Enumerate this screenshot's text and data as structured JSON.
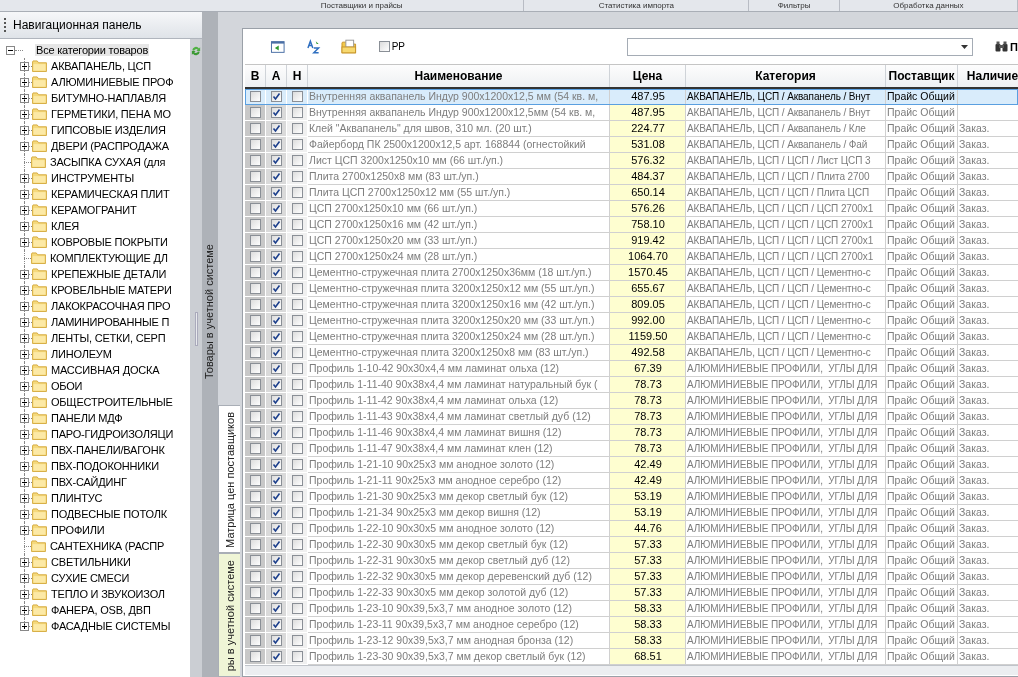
{
  "ribbon_tabs": [
    {
      "label": "Поставщики и прайсы"
    },
    {
      "label": "Статистика импорта"
    },
    {
      "label": "Фильтры"
    },
    {
      "label": "Обработка данных"
    }
  ],
  "nav_panel": {
    "title": "Навигационная панель",
    "tree": {
      "label": "Все категории товаров",
      "expanded": true,
      "selected": true,
      "children": [
        {
          "label": "АКВАПАНЕЛЬ, ЦСП",
          "expandable": true,
          "selected": false
        },
        {
          "label": "АЛЮМИНИЕВЫЕ ПРОФ",
          "expandable": true,
          "selected": false
        },
        {
          "label": "БИТУМНО-НАПЛАВЛЯ",
          "expandable": true,
          "selected": false
        },
        {
          "label": "ГЕРМЕТИКИ, ПЕНА МО",
          "expandable": true,
          "selected": false
        },
        {
          "label": "ГИПСОВЫЕ ИЗДЕЛИЯ",
          "expandable": true,
          "selected": false
        },
        {
          "label": "ДВЕРИ (РАСПРОДАЖА",
          "expandable": true,
          "selected": false
        },
        {
          "label": "ЗАСЫПКА СУХАЯ  (для",
          "expandable": false,
          "selected": false
        },
        {
          "label": "ИНСТРУМЕНТЫ",
          "expandable": true,
          "selected": false
        },
        {
          "label": "КЕРАМИЧЕСКАЯ ПЛИТ",
          "expandable": true,
          "selected": false
        },
        {
          "label": "КЕРАМОГРАНИТ",
          "expandable": true,
          "selected": false
        },
        {
          "label": "КЛЕЯ",
          "expandable": true,
          "selected": false
        },
        {
          "label": "КОВРОВЫЕ ПОКРЫТИ",
          "expandable": true,
          "selected": false
        },
        {
          "label": "КОМПЛЕКТУЮЩИЕ ДЛ",
          "expandable": false,
          "selected": false
        },
        {
          "label": "КРЕПЕЖНЫЕ ДЕТАЛИ",
          "expandable": true,
          "selected": false
        },
        {
          "label": "КРОВЕЛЬНЫЕ МАТЕРИ",
          "expandable": true,
          "selected": false
        },
        {
          "label": "ЛАКОКРАСОЧНАЯ ПРО",
          "expandable": true,
          "selected": false
        },
        {
          "label": "ЛАМИНИРОВАННЫЕ П",
          "expandable": true,
          "selected": false
        },
        {
          "label": "ЛЕНТЫ, СЕТКИ, СЕРП",
          "expandable": true,
          "selected": false
        },
        {
          "label": "ЛИНОЛЕУМ",
          "expandable": true,
          "selected": false
        },
        {
          "label": "МАССИВНАЯ ДОСКА",
          "expandable": true,
          "selected": false
        },
        {
          "label": "ОБОИ",
          "expandable": true,
          "selected": false
        },
        {
          "label": "ОБЩЕСТРОИТЕЛЬНЫЕ",
          "expandable": true,
          "selected": false
        },
        {
          "label": "ПАНЕЛИ МДФ",
          "expandable": true,
          "selected": false
        },
        {
          "label": "ПАРО-ГИДРОИЗОЛЯЦИ",
          "expandable": true,
          "selected": false
        },
        {
          "label": "ПВХ-ПАНЕЛИ/ВАГОНК",
          "expandable": true,
          "selected": false
        },
        {
          "label": "ПВХ-ПОДОКОННИКИ",
          "expandable": true,
          "selected": false
        },
        {
          "label": "ПВХ-САЙДИНГ",
          "expandable": true,
          "selected": false
        },
        {
          "label": "ПЛИНТУС",
          "expandable": true,
          "selected": false
        },
        {
          "label": "ПОДВЕСНЫЕ ПОТОЛК",
          "expandable": true,
          "selected": false
        },
        {
          "label": "ПРОФИЛИ",
          "expandable": true,
          "selected": false
        },
        {
          "label": "САНТЕХНИКА (РАСПР",
          "expandable": false,
          "selected": false
        },
        {
          "label": "СВЕТИЛЬНИКИ",
          "expandable": true,
          "selected": false
        },
        {
          "label": "СУХИЕ СМЕСИ",
          "expandable": true,
          "selected": false
        },
        {
          "label": "ТЕПЛО И ЗВУКОИЗОЛ",
          "expandable": true,
          "selected": false
        },
        {
          "label": "ФАНЕРА,  OSB,  ДВП",
          "expandable": true,
          "selected": false
        },
        {
          "label": "ФАСАДНЫЕ СИСТЕМЫ",
          "expandable": true,
          "selected": false
        }
      ]
    }
  },
  "collapsed_panel": {
    "label": "Товары в учетной системе"
  },
  "side_tabs": [
    {
      "label": "Матрица цен поставщиков",
      "selected": true
    },
    {
      "label": "ры в учетной системе",
      "selected": false
    }
  ],
  "toolbar": {
    "pp_checkbox": {
      "label": "PP",
      "checked": false
    },
    "find_button": {
      "label": "П"
    }
  },
  "table": {
    "columns": [
      {
        "label": "В"
      },
      {
        "label": "А"
      },
      {
        "label": "Н"
      },
      {
        "label": "Наименование"
      },
      {
        "label": "Цена"
      },
      {
        "label": "Категория"
      },
      {
        "label": "Поставщик"
      },
      {
        "label": "Наличие"
      }
    ],
    "rows": [
      {
        "selected": true,
        "b": false,
        "a": true,
        "n": false,
        "name": "Внутренняя аквапанель Индур 900x1200x12,5 мм (54 кв. м,",
        "price": "487.95",
        "category": "АКВАПАНЕЛЬ, ЦСП / Аквапанель / Внут",
        "supplier": "Прайс Общий"
      },
      {
        "selected": false,
        "b": false,
        "a": true,
        "n": false,
        "name": "Внутренняя аквапанель Индур 900x1200x12,5мм (54 кв. м,",
        "price": "487.95",
        "category": "АКВАПАНЕЛЬ, ЦСП / Аквапанель / Внут",
        "supplier": "Прайс Общий"
      },
      {
        "selected": false,
        "b": false,
        "a": true,
        "n": false,
        "name": "Клей \"Аквапанель\" для швов, 310 мл. (20 шт.)",
        "price": "224.77",
        "category": "АКВАПАНЕЛЬ, ЦСП / Аквапанель / Кле",
        "supplier": "Прайс Общий",
        "availability": "Заказ."
      },
      {
        "selected": false,
        "b": false,
        "a": true,
        "n": false,
        "name": "Файерборд ПК 2500x1200x12,5 арт. 168844 (огнестойкий",
        "price": "531.08",
        "category": "АКВАПАНЕЛЬ, ЦСП / Аквапанель / Фай",
        "supplier": "Прайс Общий",
        "availability": "Заказ."
      },
      {
        "selected": false,
        "b": false,
        "a": true,
        "n": false,
        "name": "Лист ЦСП 3200x1250x10 мм (66 шт./уп.)",
        "price": "576.32",
        "category": "АКВАПАНЕЛЬ, ЦСП / ЦСП / Лист ЦСП 3",
        "supplier": "Прайс Общий",
        "availability": "Заказ."
      },
      {
        "selected": false,
        "b": false,
        "a": true,
        "n": false,
        "name": "Плита 2700x1250x8 мм (83 шт./уп.)",
        "price": "484.37",
        "category": "АКВАПАНЕЛЬ, ЦСП / ЦСП / Плита 2700",
        "supplier": "Прайс Общий",
        "availability": "Заказ."
      },
      {
        "selected": false,
        "b": false,
        "a": true,
        "n": false,
        "name": "Плита ЦСП 2700x1250x12 мм (55 шт./уп.)",
        "price": "650.14",
        "category": "АКВАПАНЕЛЬ, ЦСП / ЦСП / Плита ЦСП",
        "supplier": "Прайс Общий",
        "availability": "Заказ."
      },
      {
        "selected": false,
        "b": false,
        "a": true,
        "n": false,
        "name": "ЦСП 2700x1250x10 мм (66 шт./уп.)",
        "price": "576.26",
        "category": "АКВАПАНЕЛЬ, ЦСП / ЦСП / ЦСП 2700x1",
        "supplier": "Прайс Общий",
        "availability": "Заказ."
      },
      {
        "selected": false,
        "b": false,
        "a": true,
        "n": false,
        "name": "ЦСП 2700x1250x16 мм (42 шт./уп.)",
        "price": "758.10",
        "category": "АКВАПАНЕЛЬ, ЦСП / ЦСП / ЦСП 2700x1",
        "supplier": "Прайс Общий",
        "availability": "Заказ."
      },
      {
        "selected": false,
        "b": false,
        "a": true,
        "n": false,
        "name": "ЦСП 2700x1250x20 мм (33 шт./уп.)",
        "price": "919.42",
        "category": "АКВАПАНЕЛЬ, ЦСП / ЦСП / ЦСП 2700x1",
        "supplier": "Прайс Общий",
        "availability": "Заказ."
      },
      {
        "selected": false,
        "b": false,
        "a": true,
        "n": false,
        "name": "ЦСП 2700x1250x24 мм (28 шт./уп.)",
        "price": "1064.70",
        "category": "АКВАПАНЕЛЬ, ЦСП / ЦСП / ЦСП 2700x1",
        "supplier": "Прайс Общий",
        "availability": "Заказ."
      },
      {
        "selected": false,
        "b": false,
        "a": true,
        "n": false,
        "name": "Цементно-стружечная плита 2700x1250x36мм (18 шт./уп.)",
        "price": "1570.45",
        "category": "АКВАПАНЕЛЬ, ЦСП / ЦСП / Цементно-с",
        "supplier": "Прайс Общий",
        "availability": "Заказ."
      },
      {
        "selected": false,
        "b": false,
        "a": true,
        "n": false,
        "name": "Цементно-стружечная плита 3200x1250x12 мм (55 шт./уп.)",
        "price": "655.67",
        "category": "АКВАПАНЕЛЬ, ЦСП / ЦСП / Цементно-с",
        "supplier": "Прайс Общий",
        "availability": "Заказ."
      },
      {
        "selected": false,
        "b": false,
        "a": true,
        "n": false,
        "name": "Цементно-стружечная плита 3200x1250x16 мм (42 шт./уп.)",
        "price": "809.05",
        "category": "АКВАПАНЕЛЬ, ЦСП / ЦСП / Цементно-с",
        "supplier": "Прайс Общий",
        "availability": "Заказ."
      },
      {
        "selected": false,
        "b": false,
        "a": true,
        "n": false,
        "name": "Цементно-стружечная плита 3200x1250x20 мм (33 шт./уп.)",
        "price": "992.00",
        "category": "АКВАПАНЕЛЬ, ЦСП / ЦСП / Цементно-с",
        "supplier": "Прайс Общий",
        "availability": "Заказ."
      },
      {
        "selected": false,
        "b": false,
        "a": true,
        "n": false,
        "name": "Цементно-стружечная плита 3200x1250x24 мм (28 шт./уп.)",
        "price": "1159.50",
        "category": "АКВАПАНЕЛЬ, ЦСП / ЦСП / Цементно-с",
        "supplier": "Прайс Общий",
        "availability": "Заказ."
      },
      {
        "selected": false,
        "b": false,
        "a": true,
        "n": false,
        "name": "Цементно-стружечная плита 3200x1250x8 мм (83 шт./уп.)",
        "price": "492.58",
        "category": "АКВАПАНЕЛЬ, ЦСП / ЦСП / Цементно-с",
        "supplier": "Прайс Общий",
        "availability": "Заказ."
      },
      {
        "selected": false,
        "b": false,
        "a": true,
        "n": false,
        "name": "Профиль 1-10-42 90x30x4,4 мм ламинат ольха (12)",
        "price": "67.39",
        "category": "АЛЮМИНИЕВЫЕ ПРОФИЛИ,  УГЛЫ ДЛЯ",
        "supplier": "Прайс Общий",
        "availability": "Заказ."
      },
      {
        "selected": false,
        "b": false,
        "a": true,
        "n": false,
        "name": "Профиль 1-11-40 90x38x4,4 мм ламинат натуральный бук (",
        "price": "78.73",
        "category": "АЛЮМИНИЕВЫЕ ПРОФИЛИ,  УГЛЫ ДЛЯ",
        "supplier": "Прайс Общий",
        "availability": "Заказ."
      },
      {
        "selected": false,
        "b": false,
        "a": true,
        "n": false,
        "name": "Профиль 1-11-42 90x38x4,4 мм ламинат ольха (12)",
        "price": "78.73",
        "category": "АЛЮМИНИЕВЫЕ ПРОФИЛИ,  УГЛЫ ДЛЯ",
        "supplier": "Прайс Общий",
        "availability": "Заказ."
      },
      {
        "selected": false,
        "b": false,
        "a": true,
        "n": false,
        "name": "Профиль 1-11-43 90x38x4,4 мм ламинат светлый дуб (12)",
        "price": "78.73",
        "category": "АЛЮМИНИЕВЫЕ ПРОФИЛИ,  УГЛЫ ДЛЯ",
        "supplier": "Прайс Общий",
        "availability": "Заказ."
      },
      {
        "selected": false,
        "b": false,
        "a": true,
        "n": false,
        "name": "Профиль 1-11-46 90x38x4,4 мм ламинат вишня (12)",
        "price": "78.73",
        "category": "АЛЮМИНИЕВЫЕ ПРОФИЛИ,  УГЛЫ ДЛЯ",
        "supplier": "Прайс Общий",
        "availability": "Заказ."
      },
      {
        "selected": false,
        "b": false,
        "a": true,
        "n": false,
        "name": "Профиль 1-11-47 90x38x4,4 мм ламинат клен (12)",
        "price": "78.73",
        "category": "АЛЮМИНИЕВЫЕ ПРОФИЛИ,  УГЛЫ ДЛЯ",
        "supplier": "Прайс Общий",
        "availability": "Заказ."
      },
      {
        "selected": false,
        "b": false,
        "a": true,
        "n": false,
        "name": "Профиль 1-21-10 90x25x3 мм анодное золото (12)",
        "price": "42.49",
        "category": "АЛЮМИНИЕВЫЕ ПРОФИЛИ,  УГЛЫ ДЛЯ",
        "supplier": "Прайс Общий",
        "availability": "Заказ."
      },
      {
        "selected": false,
        "b": false,
        "a": true,
        "n": false,
        "name": "Профиль 1-21-11 90x25x3 мм анодное серебро (12)",
        "price": "42.49",
        "category": "АЛЮМИНИЕВЫЕ ПРОФИЛИ,  УГЛЫ ДЛЯ",
        "supplier": "Прайс Общий",
        "availability": "Заказ."
      },
      {
        "selected": false,
        "b": false,
        "a": true,
        "n": false,
        "name": "Профиль 1-21-30 90x25x3 мм декор светлый бук (12)",
        "price": "53.19",
        "category": "АЛЮМИНИЕВЫЕ ПРОФИЛИ,  УГЛЫ ДЛЯ",
        "supplier": "Прайс Общий",
        "availability": "Заказ."
      },
      {
        "selected": false,
        "b": false,
        "a": true,
        "n": false,
        "name": "Профиль 1-21-34 90x25x3 мм декор вишня (12)",
        "price": "53.19",
        "category": "АЛЮМИНИЕВЫЕ ПРОФИЛИ,  УГЛЫ ДЛЯ",
        "supplier": "Прайс Общий",
        "availability": "Заказ."
      },
      {
        "selected": false,
        "b": false,
        "a": true,
        "n": false,
        "name": "Профиль 1-22-10 90x30x5 мм анодное золото (12)",
        "price": "44.76",
        "category": "АЛЮМИНИЕВЫЕ ПРОФИЛИ,  УГЛЫ ДЛЯ",
        "supplier": "Прайс Общий",
        "availability": "Заказ."
      },
      {
        "selected": false,
        "b": false,
        "a": true,
        "n": false,
        "name": "Профиль 1-22-30 90x30x5 мм декор светлый бук (12)",
        "price": "57.33",
        "category": "АЛЮМИНИЕВЫЕ ПРОФИЛИ,  УГЛЫ ДЛЯ",
        "supplier": "Прайс Общий",
        "availability": "Заказ."
      },
      {
        "selected": false,
        "b": false,
        "a": true,
        "n": false,
        "name": "Профиль 1-22-31 90x30x5 мм декор светлый дуб (12)",
        "price": "57.33",
        "category": "АЛЮМИНИЕВЫЕ ПРОФИЛИ,  УГЛЫ ДЛЯ",
        "supplier": "Прайс Общий",
        "availability": "Заказ."
      },
      {
        "selected": false,
        "b": false,
        "a": true,
        "n": false,
        "name": "Профиль 1-22-32 90x30x5 мм декор деревенский дуб (12)",
        "price": "57.33",
        "category": "АЛЮМИНИЕВЫЕ ПРОФИЛИ,  УГЛЫ ДЛЯ",
        "supplier": "Прайс Общий",
        "availability": "Заказ."
      },
      {
        "selected": false,
        "b": false,
        "a": true,
        "n": false,
        "name": "Профиль 1-22-33 90x30x5 мм декор золотой дуб (12)",
        "price": "57.33",
        "category": "АЛЮМИНИЕВЫЕ ПРОФИЛИ,  УГЛЫ ДЛЯ",
        "supplier": "Прайс Общий",
        "availability": "Заказ."
      },
      {
        "selected": false,
        "b": false,
        "a": true,
        "n": false,
        "name": "Профиль 1-23-10 90x39,5x3,7 мм анодное золото (12)",
        "price": "58.33",
        "category": "АЛЮМИНИЕВЫЕ ПРОФИЛИ,  УГЛЫ ДЛЯ",
        "supplier": "Прайс Общий",
        "availability": "Заказ."
      },
      {
        "selected": false,
        "b": false,
        "a": true,
        "n": false,
        "name": "Профиль 1-23-11 90x39,5x3,7 мм анодное серебро (12)",
        "price": "58.33",
        "category": "АЛЮМИНИЕВЫЕ ПРОФИЛИ,  УГЛЫ ДЛЯ",
        "supplier": "Прайс Общий",
        "availability": "Заказ."
      },
      {
        "selected": false,
        "b": false,
        "a": true,
        "n": false,
        "name": "Профиль 1-23-12 90x39,5x3,7 мм анодная бронза (12)",
        "price": "58.33",
        "category": "АЛЮМИНИЕВЫЕ ПРОФИЛИ,  УГЛЫ ДЛЯ",
        "supplier": "Прайс Общий",
        "availability": "Заказ."
      },
      {
        "selected": false,
        "b": false,
        "a": true,
        "n": false,
        "name": "Профиль 1-23-30 90x39,5x3,7 мм декор светлый бук (12)",
        "price": "68.51",
        "category": "АЛЮМИНИЕВЫЕ ПРОФИЛИ,  УГЛЫ ДЛЯ",
        "supplier": "Прайс Общий",
        "availability": "Заказ."
      }
    ]
  }
}
